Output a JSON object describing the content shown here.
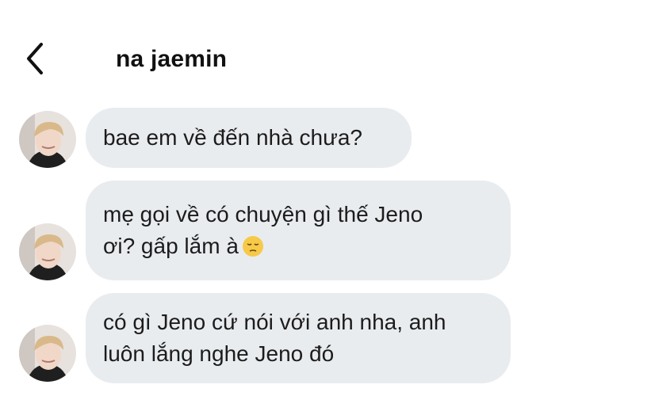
{
  "header": {
    "title": "na jaemin",
    "back_icon": "chevron-left-icon"
  },
  "messages": [
    {
      "text": "bae em về đến nhà chưa?",
      "emoji": ""
    },
    {
      "text": "mẹ gọi về có chuyện gì thế Jeno\nơi? gấp lắm à",
      "emoji": "pensive-face"
    },
    {
      "text": "có gì Jeno cứ nói với anh nha, anh\nluôn lắng nghe Jeno đó",
      "emoji": ""
    }
  ],
  "colors": {
    "bubble_bg": "#e9ecef",
    "text": "#1c1c1c",
    "background": "#ffffff"
  }
}
